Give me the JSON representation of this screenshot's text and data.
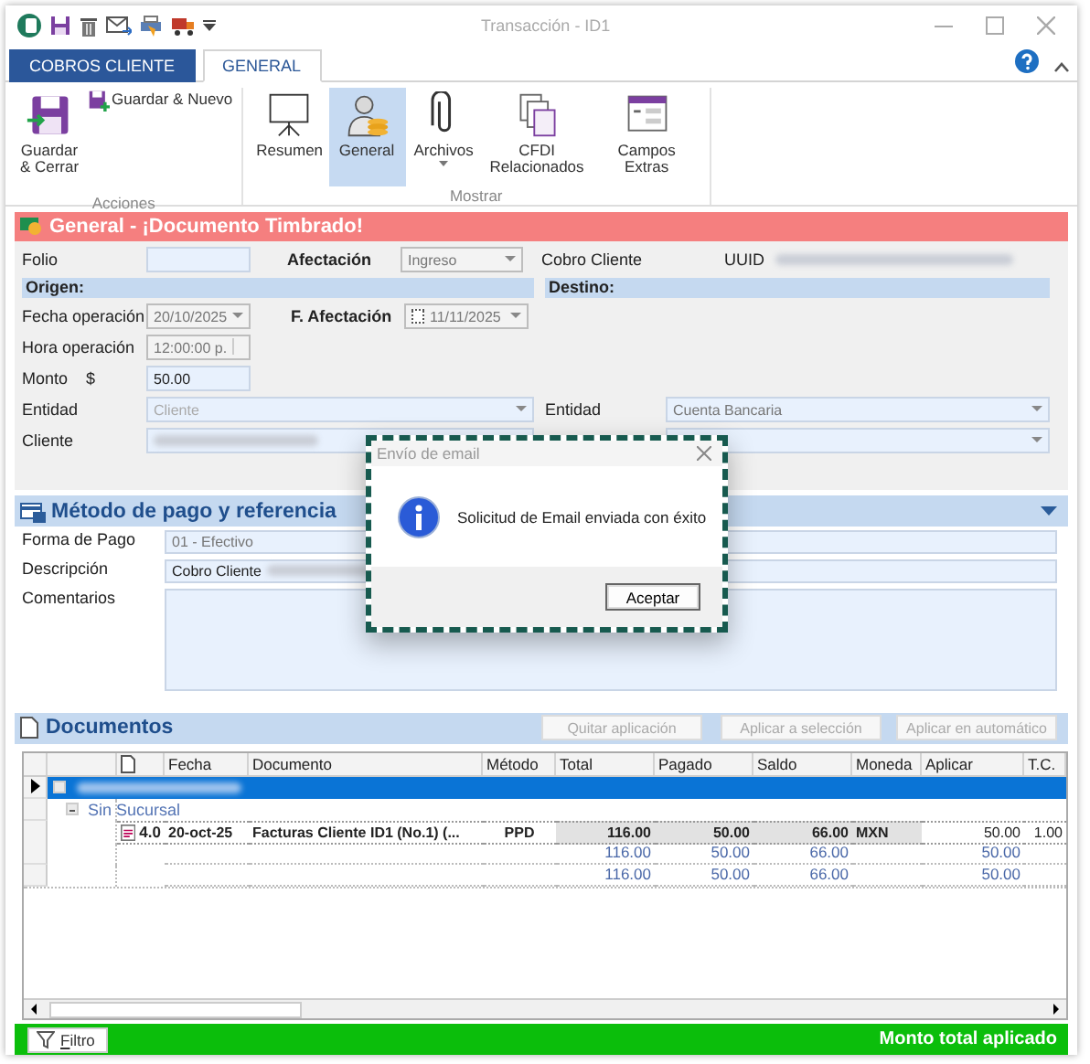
{
  "window": {
    "title": "Transacción - ID1"
  },
  "ribbon_tabs": [
    {
      "label": "COBROS CLIENTE",
      "kind": "app",
      "selected": false
    },
    {
      "label": "GENERAL",
      "kind": "tab",
      "selected": true
    }
  ],
  "ribbon_groups": [
    {
      "label": "Acciones",
      "buttons": [
        {
          "label": "Guardar & Cerrar",
          "selected": false
        },
        {
          "label": "Guardar & Nuevo",
          "selected": false
        }
      ]
    },
    {
      "label": "Mostrar",
      "buttons": [
        {
          "label": "Resumen",
          "selected": false
        },
        {
          "label": "General",
          "selected": true
        },
        {
          "label": "Archivos",
          "selected": false
        },
        {
          "label": "CFDI Relacionados",
          "selected": false
        },
        {
          "label": "Campos Extras",
          "selected": false
        }
      ]
    }
  ],
  "banner": {
    "title": "General - ¡Documento Timbrado!"
  },
  "form": {
    "folio": {
      "label": "Folio"
    },
    "afectacion": {
      "label": "Afectación",
      "value": "Ingreso"
    },
    "cobro_cliente": {
      "label": "Cobro Cliente"
    },
    "uuid": {
      "label": "UUID"
    },
    "origen": "Origen:",
    "destino": "Destino:",
    "fecha_operacion": {
      "label": "Fecha operación",
      "value": "20/10/2025"
    },
    "f_afectacion": {
      "label": "F. Afectación",
      "value": "11/11/2025",
      "checked": false
    },
    "hora_operacion": {
      "label": "Hora operación",
      "value": "12:00:00 p."
    },
    "monto": {
      "label": "Monto",
      "currency": "$",
      "value": "50.00"
    },
    "entidad_origen": {
      "label": "Entidad",
      "value": "Cliente"
    },
    "cliente": {
      "label": "Cliente"
    },
    "entidad_destino": {
      "label": "Entidad",
      "value": "Cuenta Bancaria"
    }
  },
  "metodo": {
    "title": "Método de pago y referencia",
    "fields": [
      {
        "label": "Forma de Pago",
        "value": "01 - Efectivo",
        "kind": "input"
      },
      {
        "label": "Descripción",
        "value": "Cobro Cliente",
        "kind": "input"
      },
      {
        "label": "Comentarios",
        "kind": "textarea"
      }
    ]
  },
  "documentos": {
    "title": "Documentos",
    "buttons": [
      "Quitar aplicación",
      "Aplicar a selección",
      "Aplicar en automático"
    ],
    "columns": [
      "Fecha",
      "Documento",
      "Método",
      "Total",
      "Pagado",
      "Saldo",
      "Moneda",
      "Aplicar",
      "T.C."
    ],
    "rows": [
      {
        "kind": "group",
        "selected": true
      },
      {
        "kind": "subgroup",
        "label": "Sin Sucursal",
        "selected": false
      },
      {
        "kind": "item",
        "selected": false,
        "version": "4.0",
        "cells": [
          "20-oct-25",
          "Facturas Cliente ID1 (No.1)  (...",
          "PPD",
          "116.00",
          "50.00",
          "66.00",
          "MXN",
          "50.00",
          "1.00"
        ]
      },
      {
        "kind": "summary",
        "selected": false,
        "cells": [
          "",
          "",
          "",
          "116.00",
          "50.00",
          "66.00",
          "",
          "50.00",
          ""
        ]
      },
      {
        "kind": "summary",
        "selected": false,
        "cells": [
          "",
          "",
          "",
          "116.00",
          "50.00",
          "66.00",
          "",
          "50.00",
          ""
        ]
      }
    ]
  },
  "footer": {
    "filter": "Filtro",
    "status": "Monto total aplicado"
  },
  "dialog": {
    "title": "Envío de email",
    "message": "Solicitud de Email enviada con éxito",
    "button": "Aceptar"
  }
}
